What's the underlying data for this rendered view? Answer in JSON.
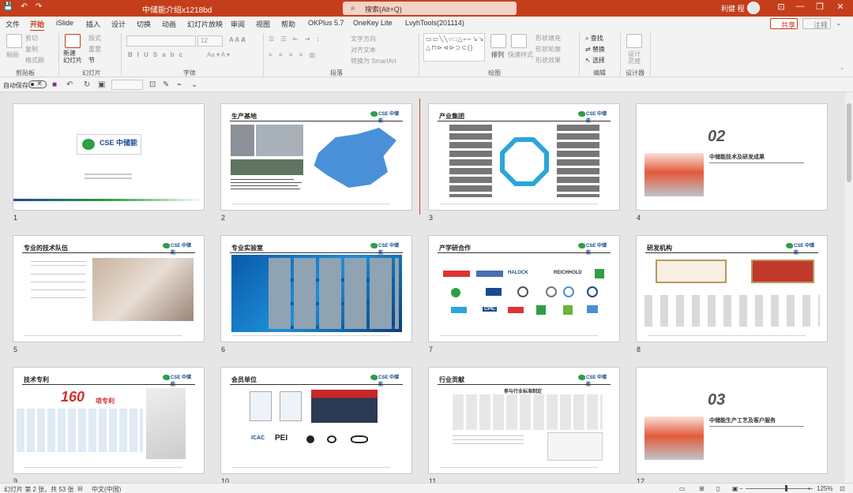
{
  "titlebar": {
    "qat": [
      "💾",
      "↶",
      "↷"
    ],
    "title": "中储能介绍x1218bd",
    "search": "搜索(Alt+Q)",
    "user": "利健 程",
    "minimize": "—",
    "restore": "❐",
    "close": "✕"
  },
  "menu": {
    "tabs": [
      "文件",
      "开始",
      "iSlide",
      "插入",
      "设计",
      "切换",
      "动画",
      "幻灯片放映",
      "审阅",
      "视图",
      "帮助",
      "OKPlus 5.7",
      "OneKey Lite",
      "LvyhTools(201114)"
    ],
    "share": "共享",
    "comment": "注释"
  },
  "ribbon": {
    "clipboard": {
      "paste": "粘贴",
      "cut": "剪切",
      "copy": "复制",
      "format_painter": "格式刷",
      "label": "剪贴板"
    },
    "slides": {
      "new_slide": "新建\n幻灯片",
      "layout": "版式",
      "reset": "重置",
      "section": "节",
      "label": "幻灯片"
    },
    "font": {
      "label": "字体",
      "size": "12"
    },
    "paragraph": {
      "text_direction": "文字方向",
      "align_text": "对齐文本",
      "convert_smartart": "转换为 SmartArt",
      "label": "段落"
    },
    "drawing": {
      "arrange": "排列",
      "quick_styles": "快速样式",
      "shape_fill": "形状填充",
      "shape_outline": "形状轮廓",
      "shape_effects": "形状效果",
      "label": "绘图"
    },
    "editing": {
      "find": "查找",
      "replace": "替换",
      "select": "选择",
      "label": "编辑"
    },
    "designer": {
      "button": "设计\n灵感",
      "label": "设计器"
    }
  },
  "qatrow": {
    "autosave": "自动保存",
    "toggle": "关"
  },
  "slides": [
    {
      "num": "1",
      "title": "",
      "logo": "CSE 中储能"
    },
    {
      "num": "2",
      "title": "生产基地",
      "logo": "CSE 中储能"
    },
    {
      "num": "3",
      "title": "产业集团",
      "logo": "CSE 中储能"
    },
    {
      "num": "4",
      "title": "",
      "big": "02",
      "subtitle": "中储能技术及研发成果"
    },
    {
      "num": "5",
      "title": "专业的技术队伍",
      "logo": "CSE 中储能"
    },
    {
      "num": "6",
      "title": "专业实验室",
      "logo": "CSE 中储能"
    },
    {
      "num": "7",
      "title": "产学研合作",
      "logo": "CSE 中储能"
    },
    {
      "num": "8",
      "title": "研发机构",
      "logo": "CSE 中储能"
    },
    {
      "num": "9",
      "title": "技术专利",
      "logo": "CSE 中储能",
      "big": "160",
      "big_suffix": "项专利"
    },
    {
      "num": "10",
      "title": "会员单位",
      "logo": "CSE 中储能"
    },
    {
      "num": "11",
      "title": "行业贡献",
      "logo": "CSE 中储能",
      "subtitle": "参与行业标准制定"
    },
    {
      "num": "12",
      "title": "",
      "big": "03",
      "subtitle": "中储能生产工艺及客户服务"
    }
  ],
  "logos": {
    "slide7": [
      "HALOCK",
      "REICHHOLD",
      "CPIC"
    ],
    "slide10": [
      "ICAC",
      "PEI"
    ]
  },
  "statusbar": {
    "slide_info": "幻灯片 第 2 张，共 53 张",
    "language": "中文(中国)",
    "zoom": "125%"
  },
  "colors": {
    "accent": "#c43e1c",
    "ribbon_bg": "#f3f3f3",
    "workspace_bg": "#e6e6e6"
  }
}
